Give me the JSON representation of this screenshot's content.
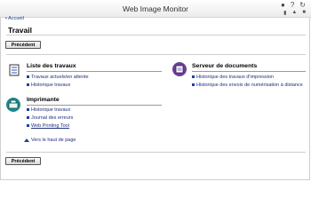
{
  "app": {
    "title": "Web Image Monitor"
  },
  "header": {
    "icons": [
      "user-icon",
      "help-icon",
      "refresh-icon"
    ],
    "small_icons": [
      "printer-icon",
      "home-icon",
      "settings-icon"
    ]
  },
  "nav": {
    "back_label": "• Accueil"
  },
  "page": {
    "title": "Travail"
  },
  "buttons": {
    "back_top": "Précédent",
    "back_bottom": "Précédent"
  },
  "sections": {
    "jobs": {
      "title": "Liste des travaux",
      "items": [
        "Travaux actuels/en attente",
        "Historique travaux"
      ]
    },
    "printer": {
      "title": "Imprimante",
      "items": [
        "Historique travaux",
        "Journal des erreurs",
        "Web Printing Tool"
      ]
    },
    "docserver": {
      "title": "Serveur de documents",
      "items": [
        "Historique des travaux d'impression",
        "Historique des envois de numérisation à distance"
      ]
    }
  },
  "totop": {
    "label": "Vers le haut de page"
  },
  "colors": {
    "link": "#1f2f7a",
    "bullet": "#1f3f9f",
    "accent_purple": "#6a3f99",
    "accent_teal": "#1d8a8a"
  }
}
